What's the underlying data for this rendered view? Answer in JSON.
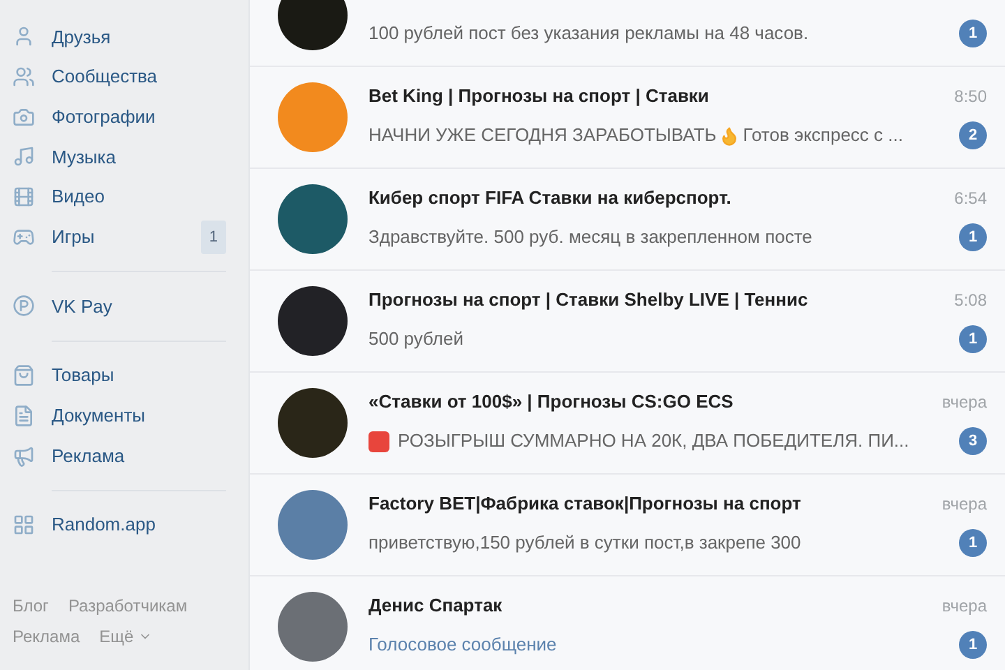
{
  "sidebar": {
    "items": [
      {
        "kind": "item",
        "label": "Друзья"
      },
      {
        "kind": "item",
        "label": "Сообщества"
      },
      {
        "kind": "item",
        "label": "Фотографии"
      },
      {
        "kind": "item",
        "label": "Музыка"
      },
      {
        "kind": "item",
        "label": "Видео"
      },
      {
        "kind": "item",
        "label": "Игры",
        "count": "1"
      },
      {
        "kind": "divider"
      },
      {
        "kind": "item",
        "label": "VK Pay"
      },
      {
        "kind": "divider"
      },
      {
        "kind": "item",
        "label": "Товары"
      },
      {
        "kind": "item",
        "label": "Документы"
      },
      {
        "kind": "item",
        "label": "Реклама"
      },
      {
        "kind": "divider"
      },
      {
        "kind": "item",
        "label": "Random.app"
      }
    ],
    "footer_links": [
      "Блог",
      "Разработчикам",
      "Реклама",
      "Ещё"
    ]
  },
  "dialogs": [
    {
      "preview": [
        {
          "kind": "text",
          "text": "100 рублей пост без указания рекламы на 48 часов."
        }
      ],
      "unread": "1"
    },
    {
      "title": "Bet King | Прогнозы на спорт | Ставки",
      "time": "8:50",
      "preview": [
        {
          "kind": "text",
          "text": "НАЧНИ УЖЕ СЕГОДНЯ ЗАРАБОТЫВАТЬ"
        },
        {
          "kind": "fire"
        },
        {
          "kind": "text",
          "text": "Готов экспресс с ..."
        }
      ],
      "unread": "2"
    },
    {
      "title": "Кибер спорт FIFA Ставки на киберспорт.",
      "time": "6:54",
      "preview": [
        {
          "kind": "text",
          "text": "Здравствуйте. 500 руб. месяц в закрепленном посте"
        }
      ],
      "unread": "1"
    },
    {
      "title": "Прогнозы на спорт | Ставки Shelby LIVE | Теннис",
      "time": "5:08",
      "preview": [
        {
          "kind": "text",
          "text": "500 рублей"
        }
      ],
      "unread": "1"
    },
    {
      "title": "«Ставки от 100$» | Прогнозы CS:GO ECS",
      "time": "вчера",
      "preview": [
        {
          "kind": "sos"
        },
        {
          "kind": "text",
          "text": "РОЗЫГРЫШ СУММАРНО НА 20К, ДВА ПОБЕДИТЕЛЯ. ПИ..."
        }
      ],
      "unread": "3"
    },
    {
      "title": "Factory BET|Фабрика ставок|Прогнозы на спорт",
      "time": "вчера",
      "preview": [
        {
          "kind": "text",
          "text": "приветствую,150 рублей в сутки пост,в закрепе 300"
        }
      ],
      "unread": "1"
    },
    {
      "title": "Денис Спартак",
      "time": "вчера",
      "preview": [
        {
          "kind": "attachment",
          "text": "Голосовое сообщение"
        }
      ],
      "unread": "1"
    }
  ]
}
